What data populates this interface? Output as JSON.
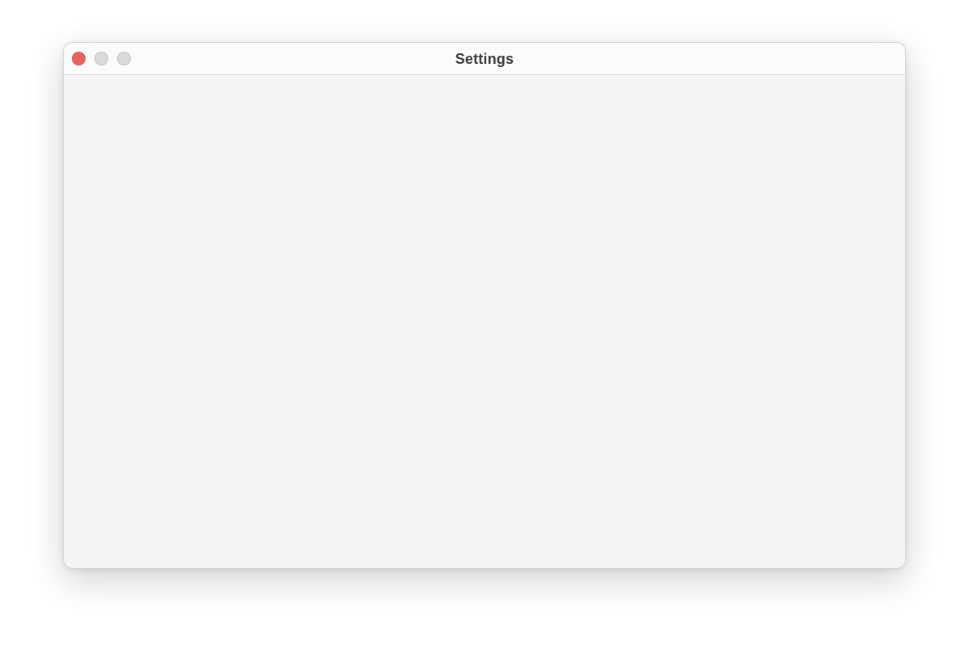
{
  "window": {
    "title": "Settings",
    "controls": {
      "close_color": "#e8625d",
      "minimize_color": "#dadada",
      "zoom_color": "#dadada"
    }
  }
}
